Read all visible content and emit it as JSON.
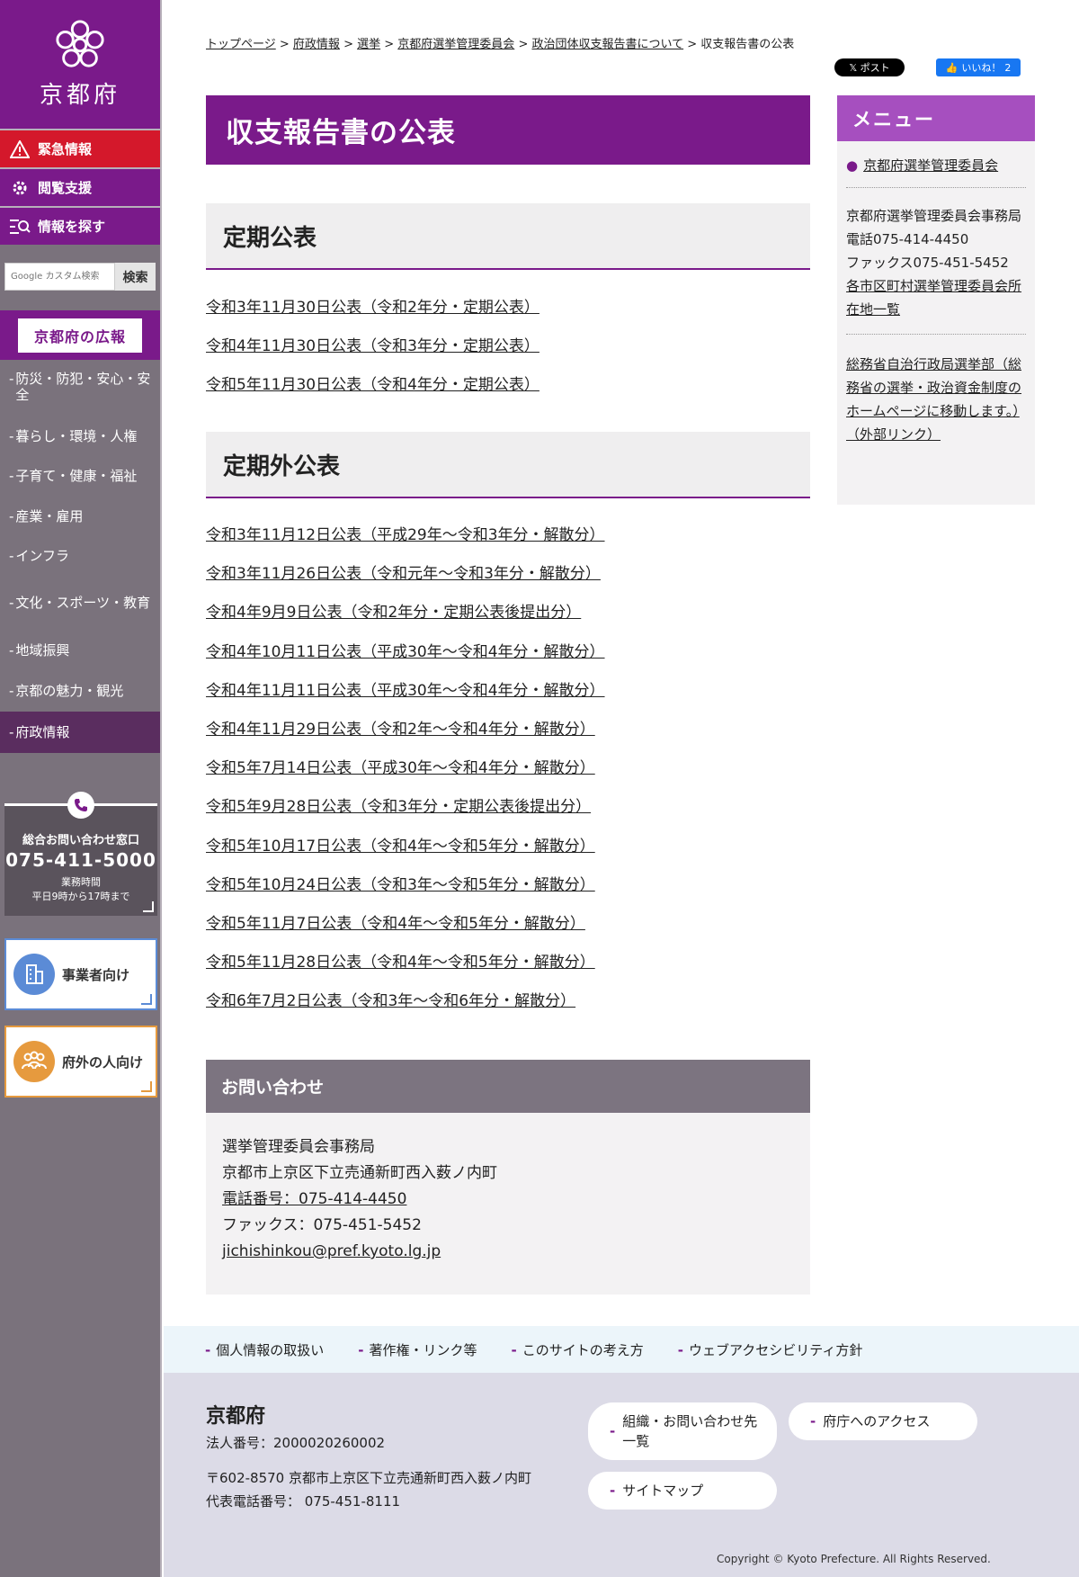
{
  "site": {
    "name": "京都府",
    "emergency": "緊急情報",
    "accessibility": "閲覧支援",
    "find_info": "情報を探す",
    "search_placeholder": "Google カスタム検索",
    "search_button": "検索",
    "pr": "京都府の広報",
    "nav": [
      "防災・防犯・安心・安全",
      "暮らし・環境・人権",
      "子育て・健康・福祉",
      "産業・雇用",
      "インフラ",
      "文化・スポーツ・教育",
      "地域振興",
      "京都の魅力・観光",
      "府政情報"
    ],
    "phone": {
      "title": "総合お問い合わせ窓口",
      "number": "075-411-5000",
      "hours_label": "業務時間",
      "hours": "平日9時から17時まで"
    },
    "business": "事業者向け",
    "outside": "府外の人向け"
  },
  "breadcrumb": [
    "トップページ",
    "府政情報",
    "選挙",
    "京都府選挙管理委員会",
    "政治団体収支報告書について",
    "収支報告書の公表"
  ],
  "social": {
    "x": "ポスト",
    "fb": "いいね！",
    "fb_count": "2"
  },
  "page_title": "収支報告書の公表",
  "sections": {
    "regular": {
      "heading": "定期公表",
      "links": [
        "令和3年11月30日公表（令和2年分・定期公表）",
        "令和4年11月30日公表（令和3年分・定期公表）",
        "令和5年11月30日公表（令和4年分・定期公表）"
      ]
    },
    "irregular": {
      "heading": "定期外公表",
      "links": [
        "令和3年11月12日公表（平成29年～令和3年分・解散分）",
        "令和3年11月26日公表（令和元年～令和3年分・解散分）",
        "令和4年9月9日公表（令和2年分・定期公表後提出分）",
        "令和4年10月11日公表（平成30年～令和4年分・解散分）",
        "令和4年11月11日公表（平成30年～令和4年分・解散分）",
        "令和4年11月29日公表（令和2年～令和4年分・解散分）",
        "令和5年7月14日公表（平成30年～令和4年分・解散分）",
        "令和5年9月28日公表（令和3年分・定期公表後提出分）",
        "令和5年10月17日公表（令和4年～令和5年分・解散分）",
        "令和5年10月24日公表（令和3年～令和5年分・解散分）",
        "令和5年11月7日公表（令和4年～令和5年分・解散分）",
        "令和5年11月28日公表（令和4年～令和5年分・解散分）",
        "令和6年7月2日公表（令和3年～令和6年分・解散分）"
      ]
    }
  },
  "contact": {
    "heading": "お問い合わせ",
    "office": "選挙管理委員会事務局",
    "address": "京都市上京区下立売通新町西入薮ノ内町",
    "phone": "電話番号：075-414-4450",
    "fax": "ファックス：075-451-5452",
    "email": "jichishinkou@pref.kyoto.lg.jp"
  },
  "menu": {
    "heading": "メニュー",
    "item": "京都府選挙管理委員会",
    "office_line1": "京都府選挙管理委員会事務局",
    "phone": "電話075-414-4450",
    "fax": "ファックス075-451-5452",
    "list_link": "各市区町村選挙管理委員会所在地一覧",
    "external": "総務省自治行政局選挙部（総務省の選挙・政治資金制度のホームページに移動します。）（外部リンク）"
  },
  "footer": {
    "links": [
      "個人情報の取扱い",
      "著作権・リンク等",
      "このサイトの考え方",
      "ウェブアクセシビリティ方針"
    ],
    "org": "京都府",
    "corp_number": "法人番号：2000020260002",
    "address": "〒602-8570 京都市上京区下立売通新町西入薮ノ内町",
    "tel": "代表電話番号： 075-451-8111",
    "org_contact": "組織・お問い合わせ先一覧",
    "access": "府庁へのアクセス",
    "sitemap": "サイトマップ",
    "copyright": "Copyright © Kyoto Prefecture. All Rights Reserved."
  },
  "colors": {
    "brand": "#7a1a8a",
    "emergency": "#d4182b",
    "menu_header": "#a64fbf",
    "sidebar": "#7a727c"
  }
}
